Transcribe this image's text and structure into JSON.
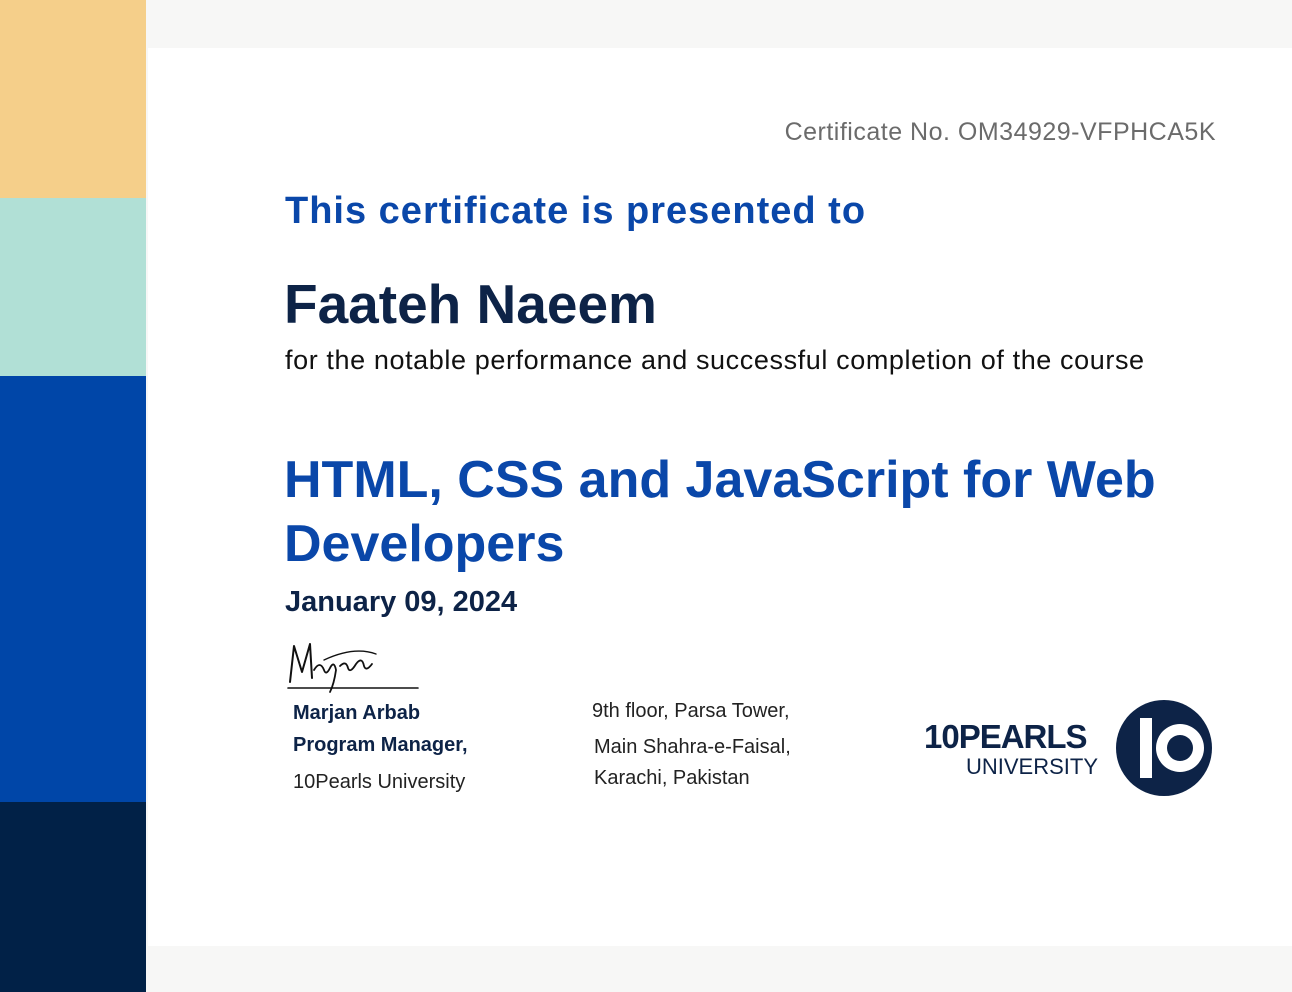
{
  "colors": {
    "stripe_1": "#f5cf8a",
    "stripe_2": "#b1e0d6",
    "stripe_3": "#0046a8",
    "stripe_4": "#012147",
    "accent_blue": "#0a47a9",
    "navy": "#0d2347"
  },
  "certificate": {
    "number": "Certificate No. OM34929-VFPHCA5K",
    "presented_to": "This certificate is presented to",
    "recipient": "Faateh Naeem",
    "description": "for the notable performance and successful completion of the course",
    "course": "HTML, CSS and JavaScript for Web Developers",
    "date": "January 09, 2024"
  },
  "signer": {
    "signature_text": "Marjan",
    "name": "Marjan Arbab",
    "role": "Program Manager,",
    "organization": "10Pearls University"
  },
  "address": {
    "line1": "9th floor, Parsa Tower,",
    "line2": "Main Shahra-e-Faisal,",
    "line3": "Karachi, Pakistan"
  },
  "logo": {
    "main_text": "10PEARLS",
    "sub_text": "UNIVERSITY",
    "icon": "10-monogram-icon"
  }
}
